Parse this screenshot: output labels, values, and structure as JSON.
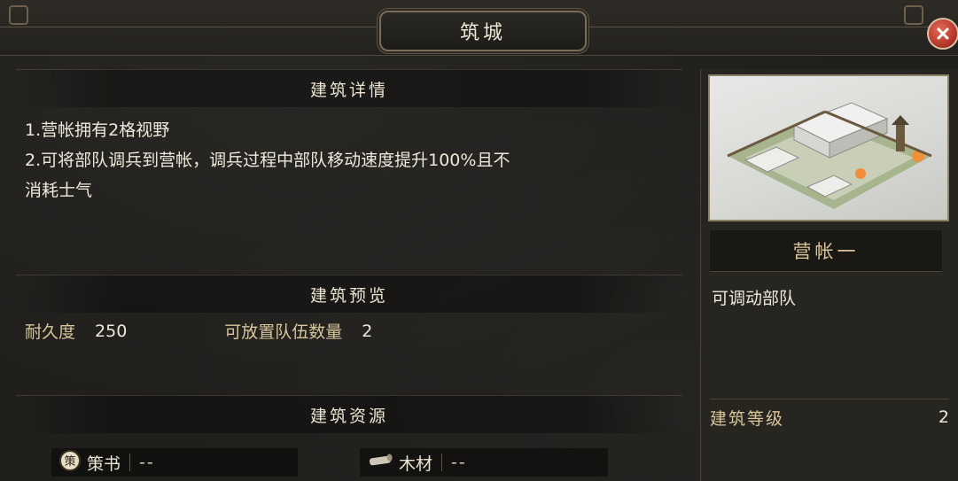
{
  "window": {
    "title": "筑城",
    "close_icon": "close-icon"
  },
  "details": {
    "header": "建筑详情",
    "lines": [
      "1.营帐拥有2格视野",
      "2.可将部队调兵到营帐，调兵过程中部队移动速度提升100%且不",
      "消耗士气"
    ]
  },
  "preview": {
    "header": "建筑预览",
    "durability_label": "耐久度",
    "durability_value": "250",
    "capacity_label": "可放置队伍数量",
    "capacity_value": "2"
  },
  "resources": {
    "header": "建筑资源",
    "items": [
      {
        "icon": "strategy-book-icon",
        "icon_glyph": "策",
        "name": "策书",
        "value": "--"
      },
      {
        "icon": "wood-icon",
        "name": "木材",
        "value": "--"
      }
    ]
  },
  "building": {
    "name": "营帐一",
    "description": "可调动部队",
    "level_label": "建筑等级",
    "level_value": "2"
  },
  "colors": {
    "accent_gold": "#d8c59b",
    "close_red": "#b8392b",
    "panel_bg": "#201f1c"
  }
}
